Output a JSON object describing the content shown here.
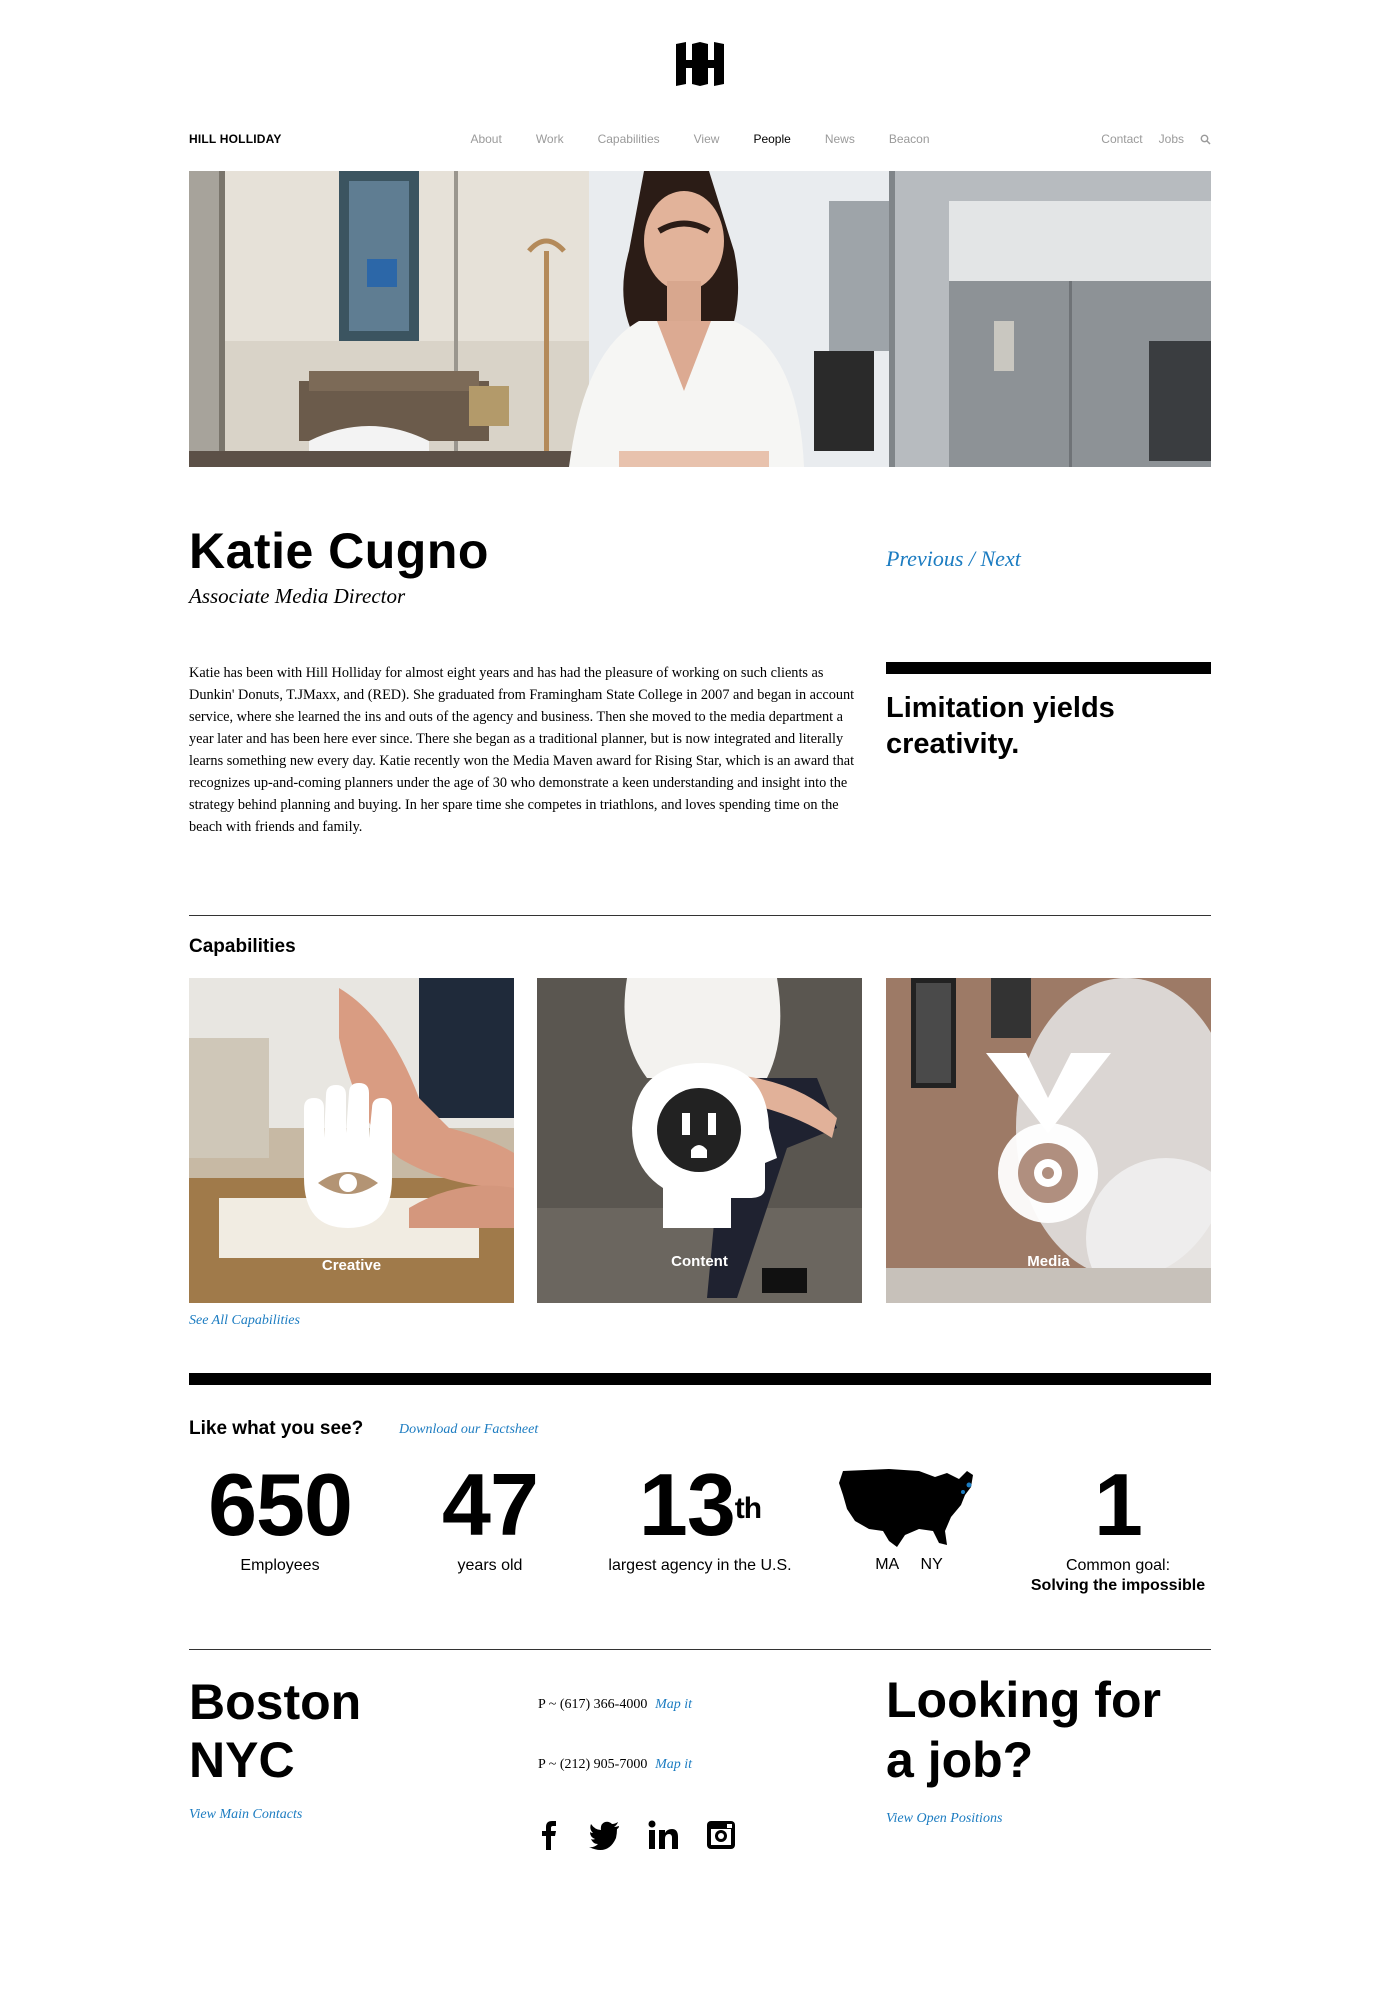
{
  "brand": "HILL HOLLIDAY",
  "nav": {
    "center": [
      "About",
      "Work",
      "Capabilities",
      "View",
      "People",
      "News",
      "Beacon"
    ],
    "active": "People",
    "right": [
      "Contact",
      "Jobs"
    ]
  },
  "profile": {
    "name": "Katie Cugno",
    "title": "Associate Media Director",
    "prev_next": "Previous / Next",
    "bio": "Katie has been with Hill Holliday for almost eight years and has had the pleasure of working on such clients as Dunkin' Donuts, T.JMaxx, and (RED). She graduated from Framingham State College in 2007 and began in account service, where she learned the ins and outs of the agency and business. Then she moved to the media department a year later and has been here ever since. There she began as a traditional planner, but is now integrated and literally learns something new every day. Katie recently won the Media Maven award for Rising Star, which is an award that recognizes up-and-coming planners under the age of 30 who demonstrate a keen understanding and insight into the strategy behind planning and buying. In her spare time she competes in triathlons, and loves spending time on the beach with friends and family.",
    "quote": "Limitation yields creativity."
  },
  "capabilities": {
    "heading": "Capabilities",
    "cards": [
      {
        "label": "Creative",
        "icon": "hand-eye-icon"
      },
      {
        "label": "Content",
        "icon": "head-outlet-icon"
      },
      {
        "label": "Media",
        "icon": "target-v-icon"
      }
    ],
    "see_all": "See All Capabilities"
  },
  "stats": {
    "heading": "Like what you see?",
    "factsheet": "Download our Factsheet",
    "items": [
      {
        "number": "650",
        "label": "Employees"
      },
      {
        "number": "47",
        "label": "years old"
      },
      {
        "number": "13",
        "suffix": "th",
        "label": "largest agency in the U.S."
      },
      {
        "map_states": "MA     NY"
      },
      {
        "number": "1",
        "label": "Common goal:",
        "label_bold": "Solving the impossible"
      }
    ]
  },
  "footer": {
    "cities": [
      "Boston",
      "NYC"
    ],
    "view_contacts": "View Main Contacts",
    "phones": [
      {
        "number": "P ~ (617) 366-4000",
        "map": "Map it"
      },
      {
        "number": "P ~ (212) 905-7000",
        "map": "Map it"
      }
    ],
    "job_heading_1": "Looking for",
    "job_heading_2": "a job?",
    "view_positions": "View Open Positions",
    "social": [
      "facebook-icon",
      "twitter-icon",
      "linkedin-icon",
      "instagram-icon"
    ]
  },
  "colors": {
    "link": "#1c7cc1",
    "text": "#000000",
    "nav_muted": "#9a9a9a"
  }
}
